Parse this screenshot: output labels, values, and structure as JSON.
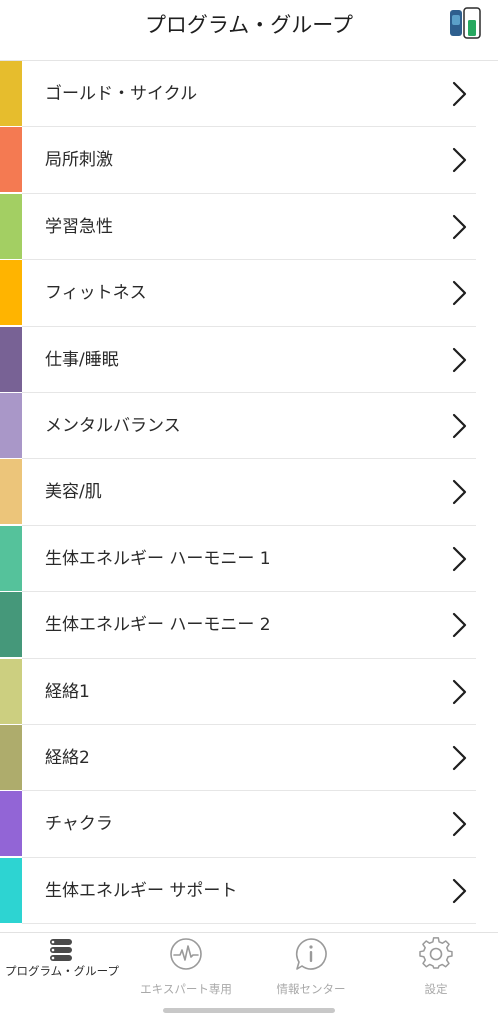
{
  "header": {
    "title": "プログラム・グループ",
    "device_icon": "device-battery-icon",
    "device_colors": [
      "#2e5f8e",
      "#27a860"
    ]
  },
  "groups": [
    {
      "label": "ゴールド・サイクル",
      "color": "#e6bd2d"
    },
    {
      "label": "局所刺激",
      "color": "#f47a52"
    },
    {
      "label": "学習急性",
      "color": "#a3cf63"
    },
    {
      "label": "フィットネス",
      "color": "#ffb400"
    },
    {
      "label": "仕事/睡眠",
      "color": "#786295"
    },
    {
      "label": "メンタルバランス",
      "color": "#a997c8"
    },
    {
      "label": "美容/肌",
      "color": "#ecc57a"
    },
    {
      "label": "生体エネルギー ハーモニー 1",
      "color": "#55c29b"
    },
    {
      "label": "生体エネルギー ハーモニー 2",
      "color": "#45987a"
    },
    {
      "label": "経絡1",
      "color": "#cccf80"
    },
    {
      "label": "経絡2",
      "color": "#aeac6c"
    },
    {
      "label": "チャクラ",
      "color": "#9265d6"
    },
    {
      "label": "生体エネルギー サポート",
      "color": "#2dd4d2"
    }
  ],
  "tabbar": {
    "tabs": [
      {
        "label": "プログラム・グループ",
        "icon": "stack-list-icon",
        "active": true
      },
      {
        "label": "エキスパート専用",
        "icon": "heartbeat-icon",
        "active": false
      },
      {
        "label": "情報センター",
        "icon": "info-bubble-icon",
        "active": false
      },
      {
        "label": "設定",
        "icon": "gear-icon",
        "active": false
      }
    ],
    "active_color": "#2b2b2b",
    "inactive_color": "#a9a9a9"
  }
}
